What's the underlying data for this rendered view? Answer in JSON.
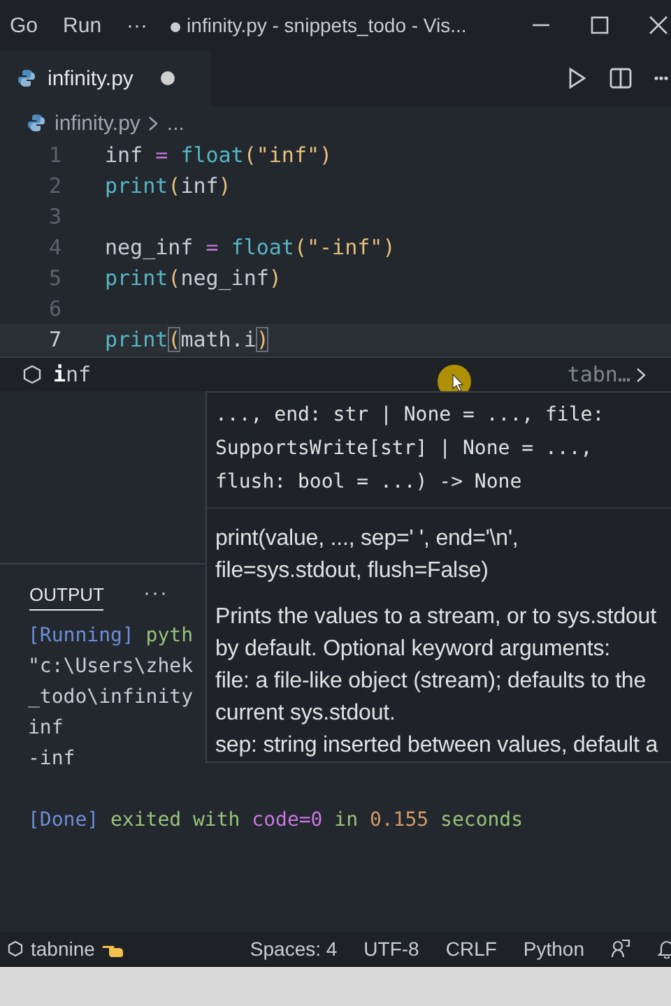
{
  "title_bar": {
    "menu": [
      "Go",
      "Run",
      "···"
    ],
    "dirty": true,
    "title": "infinity.py - snippets_todo - Vis..."
  },
  "tabs": [
    {
      "label": "infinity.py",
      "selected": true,
      "dirty": true
    }
  ],
  "breadcrumb": [
    "infinity.py",
    "..."
  ],
  "code": [
    {
      "number": "1",
      "current": false,
      "tokens": [
        {
          "text": "inf ",
          "kind": "plain"
        },
        {
          "text": "= ",
          "kind": "op"
        },
        {
          "text": "float",
          "kind": "func"
        },
        {
          "text": "(",
          "kind": "paren"
        },
        {
          "text": "\"inf\"",
          "kind": "str"
        },
        {
          "text": ")",
          "kind": "paren"
        }
      ]
    },
    {
      "number": "2",
      "current": false,
      "tokens": [
        {
          "text": "print",
          "kind": "func"
        },
        {
          "text": "(",
          "kind": "paren"
        },
        {
          "text": "inf",
          "kind": "plain"
        },
        {
          "text": ")",
          "kind": "paren"
        }
      ]
    },
    {
      "number": "3",
      "current": false
    },
    {
      "number": "4",
      "current": false,
      "tokens": [
        {
          "text": "neg_inf ",
          "kind": "plain"
        },
        {
          "text": "= ",
          "kind": "op"
        },
        {
          "text": "float",
          "kind": "func"
        },
        {
          "text": "(",
          "kind": "paren"
        },
        {
          "text": "\"-inf\"",
          "kind": "str"
        },
        {
          "text": ")",
          "kind": "paren"
        }
      ]
    },
    {
      "number": "5",
      "current": false,
      "tokens": [
        {
          "text": "print",
          "kind": "func"
        },
        {
          "text": "(",
          "kind": "paren"
        },
        {
          "text": "neg_inf",
          "kind": "plain"
        },
        {
          "text": ")",
          "kind": "paren"
        }
      ]
    },
    {
      "number": "6",
      "current": false
    },
    {
      "number": "7",
      "current": true,
      "tokens": [
        {
          "text": "print",
          "kind": "func"
        },
        {
          "text": "(",
          "kind": "match"
        },
        {
          "text": "math.i",
          "kind": "plain"
        },
        {
          "text": ")",
          "kind": "match"
        }
      ]
    }
  ],
  "suggestion": {
    "label": "**i**nf",
    "source": "tabn…"
  },
  "hover": {
    "signature": [
      "..., end: str | None = ..., file:",
      "SupportsWrite[str] | None = ...,",
      "flush: bool = ...) -> None"
    ],
    "doc_signature": [
      "print(value, ..., sep=' ', end='\\n',",
      "file=sys.stdout, flush=False)"
    ],
    "description": [
      "Prints the values to a stream, or to sys.stdout",
      "by default. Optional keyword arguments:",
      "file: a file-like object (stream); defaults to the",
      "current sys.stdout.",
      "sep: string inserted between values, default a"
    ]
  },
  "panel": {
    "tabs": [
      {
        "label": "OUTPUT",
        "selected": true
      }
    ],
    "more": "···",
    "output": [
      [
        {
          "text": "[Running]",
          "kind": "tag"
        },
        {
          "text": " pyth",
          "kind": "ok"
        }
      ],
      [
        {
          "text": "\"c:\\Users\\zhek",
          "kind": "plain"
        }
      ],
      [
        {
          "text": "_todo\\infinity",
          "kind": "plain"
        }
      ],
      [
        {
          "text": "inf",
          "kind": "plain"
        }
      ],
      [
        {
          "text": "-inf",
          "kind": "plain"
        }
      ]
    ],
    "result": [
      {
        "text": "[Done]",
        "kind": "tag"
      },
      {
        "text": " exited with ",
        "kind": "ok"
      },
      {
        "text": "code=0",
        "kind": "code"
      },
      {
        "text": " in ",
        "kind": "ok"
      },
      {
        "text": "0.155",
        "kind": "num"
      },
      {
        "text": " seconds",
        "kind": "ok"
      }
    ]
  },
  "status_bar": {
    "left": "tabnine",
    "items": [
      "Spaces: 4",
      "UTF-8",
      "CRLF",
      "Python"
    ]
  }
}
